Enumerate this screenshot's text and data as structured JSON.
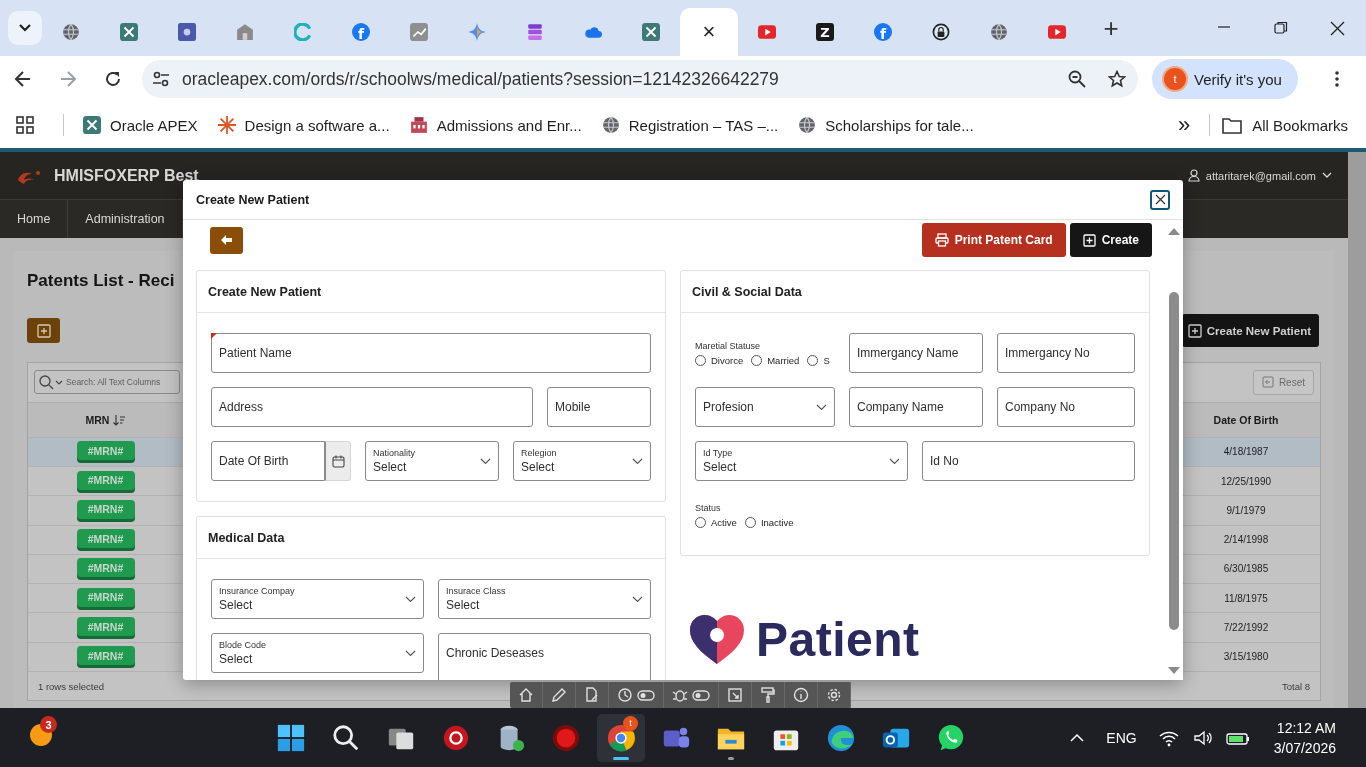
{
  "browser": {
    "tabs": [
      {
        "kind": "globe",
        "selected": false
      },
      {
        "kind": "apex",
        "selected": false
      },
      {
        "kind": "square",
        "selected": false
      },
      {
        "kind": "house",
        "selected": false
      },
      {
        "kind": "swirl",
        "selected": false
      },
      {
        "kind": "facebook",
        "glyph": "f",
        "selected": false
      },
      {
        "kind": "chart",
        "selected": false
      },
      {
        "kind": "sparkle",
        "selected": false
      },
      {
        "kind": "stack",
        "selected": false
      },
      {
        "kind": "cloud",
        "selected": false
      },
      {
        "kind": "apex",
        "selected": false
      },
      {
        "kind": "blank",
        "close": "×",
        "selected": true
      },
      {
        "kind": "youtube",
        "selected": false
      },
      {
        "kind": "letter",
        "glyph": "Z",
        "selected": false
      },
      {
        "kind": "facebook",
        "glyph": "f",
        "selected": false
      },
      {
        "kind": "lock",
        "selected": false
      },
      {
        "kind": "globe",
        "selected": false
      },
      {
        "kind": "youtube",
        "selected": false
      }
    ],
    "new_tab": "+",
    "url": "oracleapex.com/ords/r/schoolws/medical/patients?session=12142326642279",
    "profile": {
      "avatar": "t",
      "label": "Verify it's you"
    },
    "bookmarks": [
      {
        "kind": "apex",
        "label": "Oracle APEX"
      },
      {
        "kind": "burst",
        "label": "Design a software a..."
      },
      {
        "kind": "school",
        "label": "Admissions and Enr..."
      },
      {
        "kind": "globe",
        "label": "Registration – TAS –..."
      },
      {
        "kind": "globe",
        "label": "Scholarships for tale..."
      }
    ],
    "more": "»",
    "all_bookmarks": "All Bookmarks"
  },
  "app": {
    "title": "HMISFOXERP Best",
    "user": "attaritarek@gmail.com",
    "nav": [
      {
        "label": "Home"
      },
      {
        "label": "Administration"
      }
    ],
    "page_title": "Patents List - Reci",
    "create_button": "Create New Patient",
    "search_placeholder": "Search: All Text Columns",
    "reset": "Reset",
    "columns": [
      "MRN",
      "Date Of Birth"
    ],
    "rows": [
      {
        "mrn": "#MRN#",
        "dob": "4/18/1987",
        "selected": true
      },
      {
        "mrn": "#MRN#",
        "dob": "12/25/1990",
        "selected": false
      },
      {
        "mrn": "#MRN#",
        "dob": "9/1/1979",
        "selected": false
      },
      {
        "mrn": "#MRN#",
        "dob": "2/14/1998",
        "selected": false
      },
      {
        "mrn": "#MRN#",
        "dob": "6/30/1985",
        "selected": false
      },
      {
        "mrn": "#MRN#",
        "dob": "11/8/1975",
        "selected": false
      },
      {
        "mrn": "#MRN#",
        "dob": "7/22/1992",
        "selected": false
      },
      {
        "mrn": "#MRN#",
        "dob": "3/15/1980",
        "selected": false
      }
    ],
    "selection_status": "1 rows selected",
    "total": "Total 8"
  },
  "modal": {
    "title": "Create New Patient",
    "print_button": "Print Patent Card",
    "create_button": "Create",
    "patient_card": {
      "title": "Create New Patient",
      "rows": [
        [
          {
            "kind": "text",
            "label": "Patient Name",
            "required": true
          }
        ],
        [
          {
            "kind": "text",
            "label": "Address",
            "required": false
          },
          {
            "kind": "text",
            "label": "Mobile",
            "required": false
          }
        ],
        [
          {
            "kind": "date",
            "label": "Date Of Birth",
            "required": false
          },
          {
            "kind": "select",
            "label": "Nationality",
            "value": "Select",
            "required": false
          },
          {
            "kind": "select",
            "label": "Relegion",
            "value": "Select",
            "required": false
          }
        ]
      ]
    },
    "medical_card": {
      "title": "Medical Data",
      "rows": [
        [
          {
            "kind": "select",
            "label": "Insurance Compay",
            "value": "Select",
            "required": false
          },
          {
            "kind": "select",
            "label": "Insurace Class",
            "value": "Select",
            "required": false
          }
        ],
        [
          {
            "kind": "select",
            "label": "Blode Code",
            "value": "Select",
            "required": false
          },
          {
            "kind": "textarea",
            "label": "Chronic Deseases",
            "required": false
          }
        ]
      ]
    },
    "civil_card": {
      "title": "Civil & Social Data",
      "rows": [
        [
          {
            "kind": "radio",
            "label": "Maretial Statuse",
            "options": [
              {
                "label": "Divorce",
                "selected": false
              },
              {
                "label": "Married",
                "selected": false
              },
              {
                "label": "S",
                "selected": false
              }
            ]
          },
          {
            "kind": "text",
            "label": "Immergancy Name",
            "required": false
          },
          {
            "kind": "text",
            "label": "Immergancy No",
            "required": false
          }
        ],
        [
          {
            "kind": "select",
            "label": "Profesion",
            "required": false
          },
          {
            "kind": "text",
            "label": "Company Name",
            "required": false
          },
          {
            "kind": "text",
            "label": "Company No",
            "required": false
          }
        ],
        [
          {
            "kind": "select",
            "label": "Id Type",
            "value": "Select",
            "required": false
          },
          {
            "kind": "text",
            "label": "Id No",
            "required": false
          }
        ],
        [
          {
            "kind": "radio",
            "label": "Status",
            "options": [
              {
                "label": "Active",
                "selected": false
              },
              {
                "label": "Inactive",
                "selected": false
              }
            ]
          }
        ]
      ]
    },
    "logo_text": "Patient"
  },
  "taskbar": {
    "widget_badge": "3",
    "apps": [
      {
        "kind": "windows",
        "running": false,
        "selected": false
      },
      {
        "kind": "search",
        "running": false,
        "selected": false
      },
      {
        "kind": "taskview",
        "running": false,
        "selected": false
      },
      {
        "kind": "redgear",
        "running": false,
        "selected": false
      },
      {
        "kind": "database",
        "running": false,
        "selected": false
      },
      {
        "kind": "record",
        "running": false,
        "selected": false
      },
      {
        "kind": "chrome",
        "running": true,
        "selected": true,
        "badge": "t"
      },
      {
        "kind": "teams",
        "running": false,
        "selected": false
      },
      {
        "kind": "folder",
        "running": true,
        "selected": false
      },
      {
        "kind": "store",
        "running": false,
        "selected": false
      },
      {
        "kind": "edge",
        "running": false,
        "selected": false
      },
      {
        "kind": "outlook",
        "running": false,
        "selected": false
      },
      {
        "kind": "whatsapp",
        "running": false,
        "selected": false
      }
    ],
    "language": "ENG",
    "time": "12:12 AM",
    "date": "3/07/2026"
  }
}
